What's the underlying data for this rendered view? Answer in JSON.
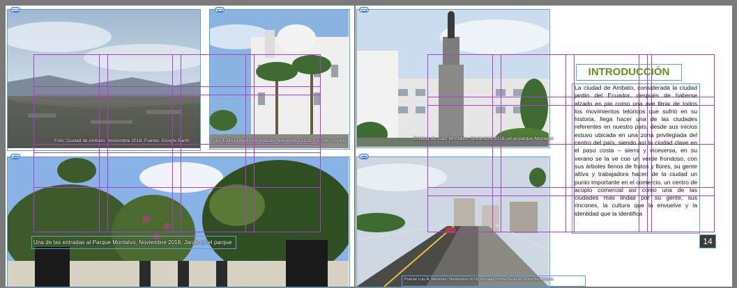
{
  "spread": {
    "left_page_caption_1": "Foto: Ciudad de Ambato. Noviembre 2018. Fuente: Google Earth",
    "left_page_caption_2": "Foto: Edificio del Hotel Ambato. Noviembre 2018. Fuente: Google",
    "left_page_caption_3": "Una de las entradas al Parque Montalvo. Noviembre 2018, Jarde en el parque",
    "right_page_caption_1": "Estatua de Juan Montalvo. Noviembre 2018, en el parque Montalvo",
    "right_page_caption_2": "Puente Luis A. Martínez. Noviembre 2018, entrada frontal hacia el centro de Ambato"
  },
  "article": {
    "title": "INTRODUCCIÓN",
    "body": "La ciudad de Ambato, considerada la ciudad jardín del Ecuador, después de haberse alzado en pie como una ave fénix de todos los movimientos telúricos que sufrió en su historia, llega hacer una de las ciudades referentes en nuestro país, desde sus inicios estuvo ubicada en una zona privilegiada del centro del país, siendo así la ciudad clave en el paso costa – sierra y viceversa, en su verano se la ve con un verde frondoso, con sus árboles llenos de frutos y flores, su gente altiva y trabajadora hacen de la ciudad un punto importante en el comercio, un centro de acopio comercial así como una de las ciudades más lindas por su gente, sus rincones, la cultura que la envuelve y la identidad que la identifica",
    "page_number": "14"
  },
  "colors": {
    "guide": "#b03ad8",
    "frame": "#5da0d8",
    "title": "#6b8a1f"
  }
}
